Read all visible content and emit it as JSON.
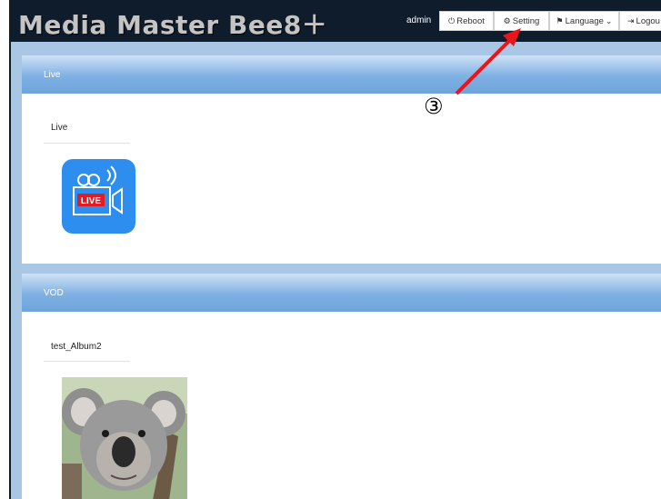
{
  "header": {
    "brand": "Media Master Bee8＋",
    "user": "admin",
    "buttons": [
      {
        "label": "Reboot",
        "icon": "power-icon"
      },
      {
        "label": "Setting",
        "icon": "gears-icon"
      },
      {
        "label": "Language",
        "icon": "language-icon"
      },
      {
        "label": "Logou",
        "icon": "logout-icon"
      }
    ]
  },
  "sections": {
    "live": {
      "title": "Live",
      "item_label": "Live",
      "badge": "LIVE"
    },
    "vod": {
      "title": "VOD",
      "item_label": "test_Album2"
    }
  },
  "annotation": {
    "callout": "③",
    "arrow_color": "#e8151b"
  },
  "colors": {
    "topbar": "#0f1c2c",
    "panel_header": "#7fb0e2",
    "live_tile": "#2d8ef0",
    "live_badge": "#e31b23"
  }
}
